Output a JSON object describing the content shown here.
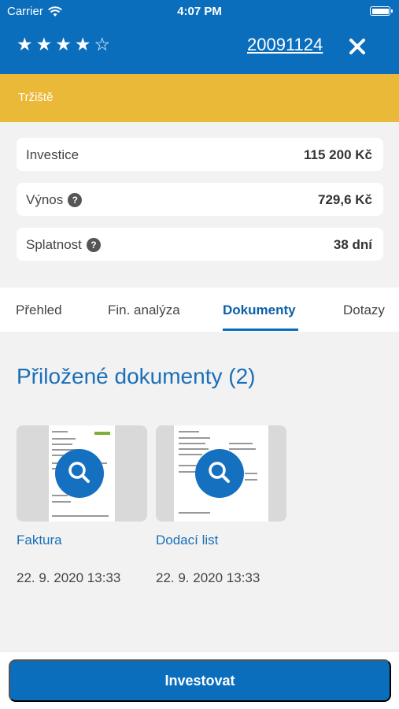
{
  "status_bar": {
    "carrier": "Carrier",
    "time": "4:07 PM"
  },
  "header": {
    "rating": {
      "filled": 4,
      "max": 5
    },
    "loan_id": "20091124",
    "colors": {
      "background": "#0a6ebd"
    }
  },
  "banner": {
    "label": "Tržiště",
    "color": "#eab938"
  },
  "stats": [
    {
      "label": "Investice",
      "value": "115 200 Kč",
      "help": false
    },
    {
      "label": "Výnos",
      "value": "729,6 Kč",
      "help": true
    },
    {
      "label": "Splatnost",
      "value": "38 dní",
      "help": true
    }
  ],
  "tabs": [
    {
      "label": "Přehled",
      "active": false
    },
    {
      "label": "Fin. analýza",
      "active": false
    },
    {
      "label": "Dokumenty",
      "active": true
    },
    {
      "label": "Dotazy",
      "active": false
    }
  ],
  "documents_section": {
    "title": "Přiložené dokumenty (2)",
    "items": [
      {
        "name": "Faktura",
        "date": "22. 9. 2020 13:33",
        "icon": "search-icon"
      },
      {
        "name": "Dodací list",
        "date": "22. 9. 2020 13:33",
        "icon": "search-icon"
      }
    ]
  },
  "actions": {
    "invest_label": "Investovat"
  }
}
